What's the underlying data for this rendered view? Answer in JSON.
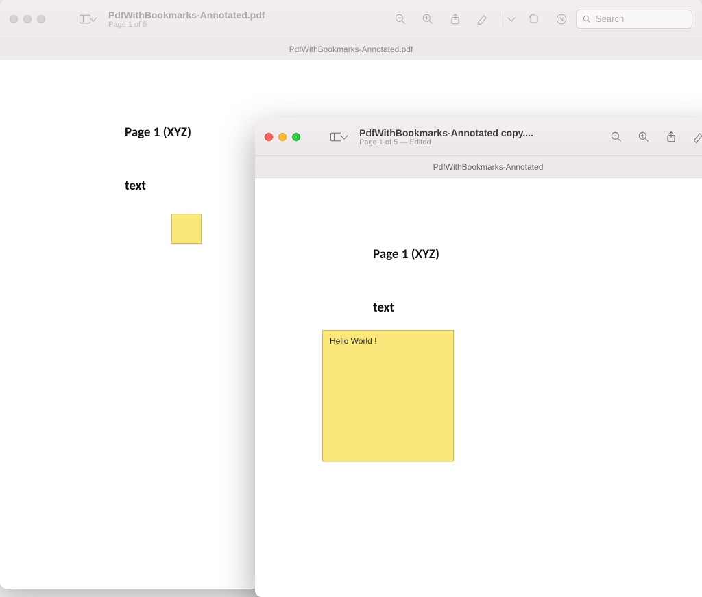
{
  "back": {
    "title": "PdfWithBookmarks-Annotated.pdf",
    "subtitle": "Page 1 of 5",
    "tab_label": "PdfWithBookmarks-Annotated.pdf",
    "search_placeholder": "Search",
    "page": {
      "heading": "Page 1 (XYZ)",
      "text_label": "text"
    }
  },
  "front": {
    "title": "PdfWithBookmarks-Annotated copy....",
    "subtitle": "Page 1 of 5 — Edited",
    "tab_label": "PdfWithBookmarks-Annotated",
    "page": {
      "heading": "Page 1 (XYZ)",
      "text_label": "text",
      "note_text": "Hello World !"
    }
  }
}
